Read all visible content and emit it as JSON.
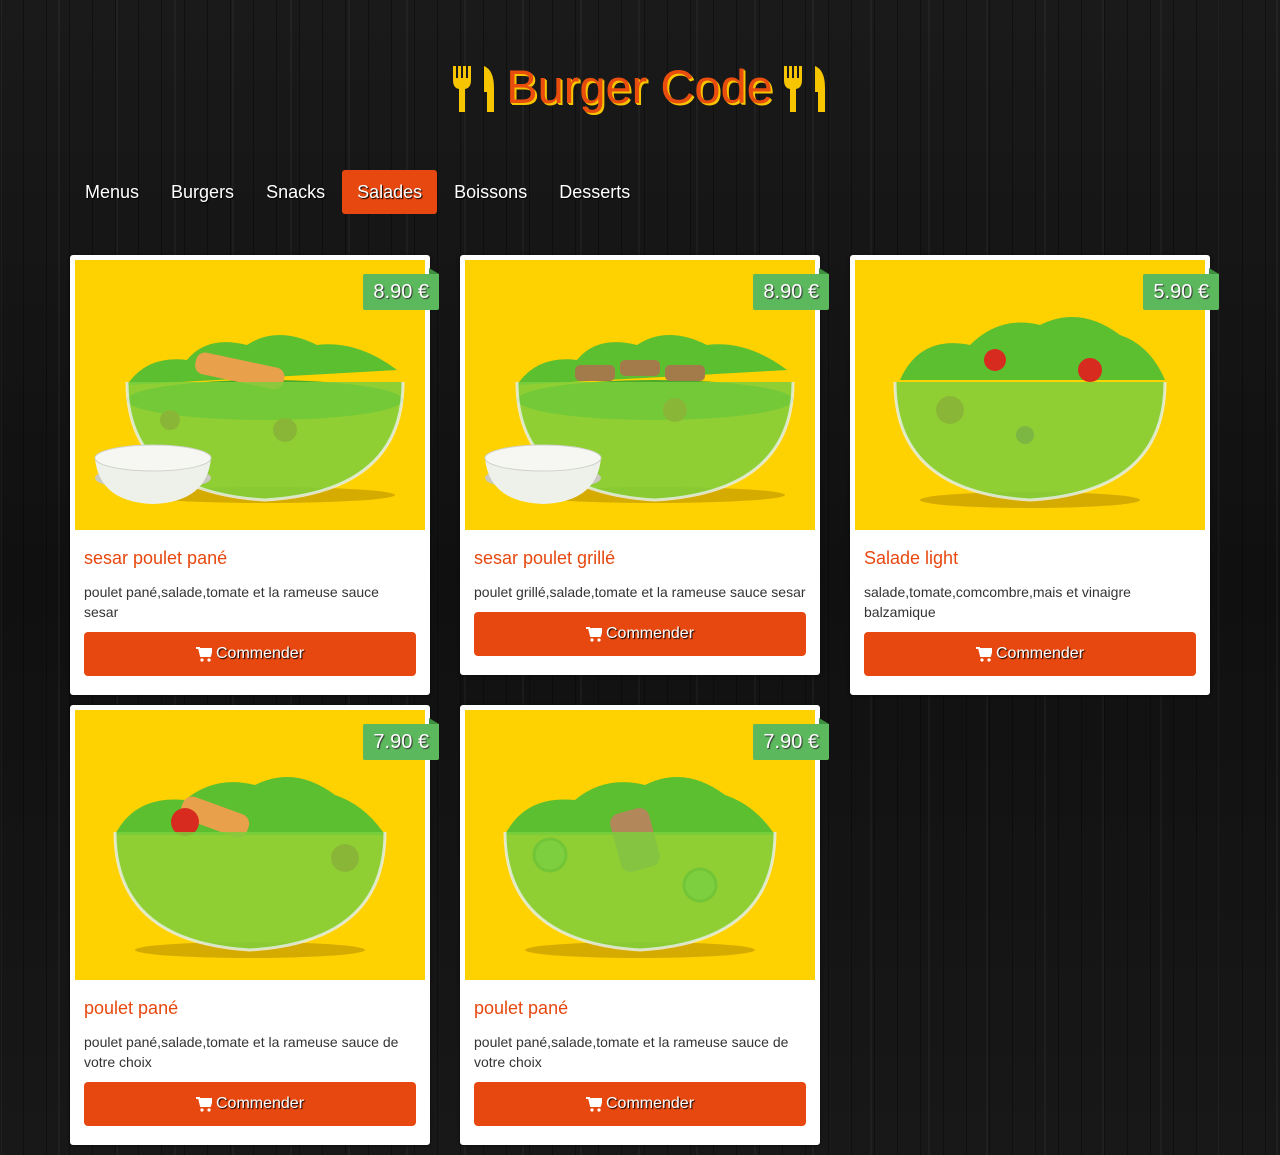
{
  "brand": {
    "title": "Burger Code",
    "color": "#e84d0e",
    "accent": "#f7c400"
  },
  "nav": {
    "items": [
      {
        "label": "Menus",
        "active": false
      },
      {
        "label": "Burgers",
        "active": false
      },
      {
        "label": "Snacks",
        "active": false
      },
      {
        "label": "Salades",
        "active": true
      },
      {
        "label": "Boissons",
        "active": false
      },
      {
        "label": "Desserts",
        "active": false
      }
    ],
    "active_color": "#e7480f"
  },
  "products": [
    {
      "name": "sesar poulet pané",
      "description": "poulet pané,salade,tomate et la rameuse sauce sesar",
      "price": "8.90 €",
      "button": "Commender",
      "image_icon": "salad-bowl-with-dip-icon"
    },
    {
      "name": "sesar poulet grillé",
      "description": "poulet grillé,salade,tomate et la rameuse sauce sesar",
      "price": "8.90 €",
      "button": "Commender",
      "image_icon": "salad-bowl-with-dip-icon"
    },
    {
      "name": "Salade light",
      "description": "salade,tomate,comcombre,mais et vinaigre balzamique",
      "price": "5.90 €",
      "button": "Commender",
      "image_icon": "salad-bowl-icon"
    },
    {
      "name": "poulet pané",
      "description": "poulet pané,salade,tomate et la rameuse sauce de votre choix",
      "price": "7.90 €",
      "button": "Commender",
      "image_icon": "salad-bowl-icon"
    },
    {
      "name": "poulet pané",
      "description": "poulet pané,salade,tomate et la rameuse sauce de votre choix",
      "price": "7.90 €",
      "button": "Commender",
      "image_icon": "salad-bowl-icon"
    }
  ],
  "colors": {
    "card_image_bg": "#fed100",
    "price_badge": "#5cb85c",
    "button": "#e7480f",
    "product_title": "#e7480f"
  }
}
